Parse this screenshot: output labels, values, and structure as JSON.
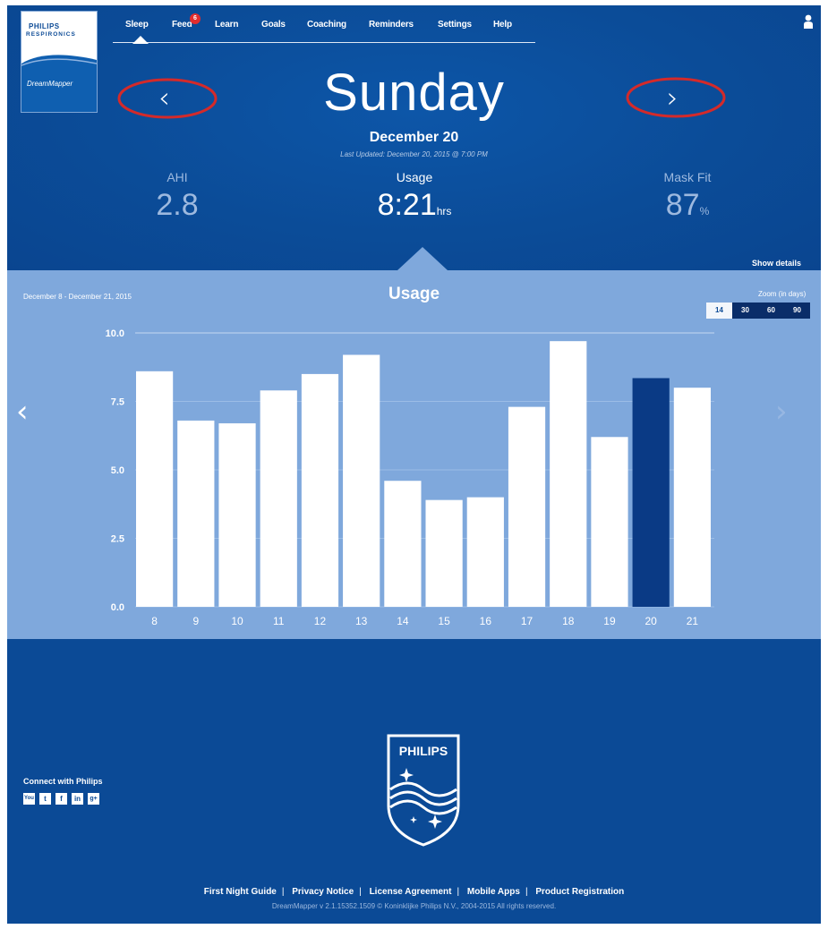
{
  "brand": {
    "logo_text": "PHILIPS",
    "logo_subtext": "RESPIRONICS",
    "app_name": "DreamMapper",
    "shield_text": "PHILIPS"
  },
  "nav": {
    "items": [
      {
        "label": "Sleep",
        "active": true
      },
      {
        "label": "Feed"
      },
      {
        "label": "Learn"
      },
      {
        "label": "Goals"
      },
      {
        "label": "Coaching"
      },
      {
        "label": "Reminders"
      },
      {
        "label": "Settings"
      },
      {
        "label": "Help"
      }
    ],
    "feed_badge": "6"
  },
  "icons": {
    "user": "user-icon",
    "prev": "chevron-left-icon",
    "next": "chevron-right-icon"
  },
  "day": {
    "weekday": "Sunday",
    "date": "December 20",
    "last_updated": "Last Updated: December 20, 2015 @ 7:00 PM"
  },
  "metrics": {
    "ahi": {
      "label": "AHI",
      "value": "2.8"
    },
    "usage": {
      "label": "Usage",
      "value": "8:21",
      "unit": "hrs"
    },
    "mask_fit": {
      "label": "Mask Fit",
      "value": "87",
      "unit": "%"
    }
  },
  "show_details": "Show details",
  "panel": {
    "range": "December 8 - December 21, 2015",
    "title": "Usage",
    "zoom_label": "Zoom (in days)",
    "zoom_options": [
      "14",
      "30",
      "60",
      "90"
    ],
    "zoom_selected": "14"
  },
  "chart_data": {
    "type": "bar",
    "title": "Usage",
    "categories": [
      "8",
      "9",
      "10",
      "11",
      "12",
      "13",
      "14",
      "15",
      "16",
      "17",
      "18",
      "19",
      "20",
      "21"
    ],
    "values": [
      8.6,
      6.8,
      6.7,
      7.9,
      8.5,
      9.2,
      4.6,
      3.9,
      4.0,
      7.3,
      9.7,
      6.2,
      8.35,
      8.0
    ],
    "highlight": "20",
    "ylim": [
      0,
      10
    ],
    "yticks": [
      "0.0",
      "2.5",
      "5.0",
      "7.5",
      "10.0"
    ],
    "ytick_values": [
      0,
      2.5,
      5,
      7.5,
      10
    ],
    "bar_color": "#ffffff",
    "highlight_color": "#0a3a85",
    "grid": true
  },
  "footer": {
    "connect_label": "Connect with Philips",
    "social": [
      "You",
      "t",
      "f",
      "in",
      "g+"
    ],
    "links": [
      "First Night Guide",
      "Privacy Notice",
      "License Agreement",
      "Mobile Apps",
      "Product Registration"
    ],
    "copyright": "DreamMapper v 2.1.15352.1509 © Koninklijke Philips N.V., 2004-2015 All rights reserved."
  },
  "colors": {
    "background": "#0b4a96",
    "panel": "#7fa8dc",
    "annotation": "#d42a2a"
  }
}
